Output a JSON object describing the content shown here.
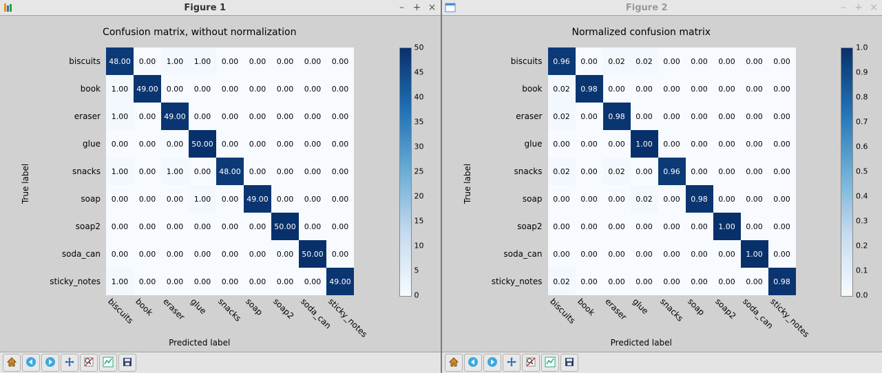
{
  "labels": [
    "biscuits",
    "book",
    "eraser",
    "glue",
    "snacks",
    "soap",
    "soap2",
    "soda_can",
    "sticky_notes"
  ],
  "toolbar_icons": [
    "home-icon",
    "back-icon",
    "forward-icon",
    "pan-icon",
    "zoom-icon",
    "subplots-icon",
    "save-icon"
  ],
  "figure1": {
    "window_title": "Figure 1",
    "chart_title": "Confusion matrix, without normalization",
    "ylabel": "True label",
    "xlabel": "Predicted label",
    "cbar_min": 0,
    "cbar_max": 50,
    "cbar_ticks": [
      0,
      5,
      10,
      15,
      20,
      25,
      30,
      35,
      40,
      45,
      50
    ]
  },
  "figure2": {
    "window_title": "Figure 2",
    "chart_title": "Normalized confusion matrix",
    "ylabel": "True label",
    "xlabel": "Predicted label",
    "cbar_min": 0.0,
    "cbar_max": 1.0,
    "cbar_ticks": [
      0.0,
      0.1,
      0.2,
      0.3,
      0.4,
      0.5,
      0.6,
      0.7,
      0.8,
      0.9,
      1.0
    ]
  },
  "window_buttons": {
    "min": "–",
    "max": "+",
    "close": "×"
  },
  "chart_data": [
    {
      "type": "heatmap",
      "title": "Confusion matrix, without normalization",
      "xlabel": "Predicted label",
      "ylabel": "True label",
      "categories": [
        "biscuits",
        "book",
        "eraser",
        "glue",
        "snacks",
        "soap",
        "soap2",
        "soda_can",
        "sticky_notes"
      ],
      "matrix": [
        [
          48.0,
          0.0,
          1.0,
          1.0,
          0.0,
          0.0,
          0.0,
          0.0,
          0.0
        ],
        [
          1.0,
          49.0,
          0.0,
          0.0,
          0.0,
          0.0,
          0.0,
          0.0,
          0.0
        ],
        [
          1.0,
          0.0,
          49.0,
          0.0,
          0.0,
          0.0,
          0.0,
          0.0,
          0.0
        ],
        [
          0.0,
          0.0,
          0.0,
          50.0,
          0.0,
          0.0,
          0.0,
          0.0,
          0.0
        ],
        [
          1.0,
          0.0,
          1.0,
          0.0,
          48.0,
          0.0,
          0.0,
          0.0,
          0.0
        ],
        [
          0.0,
          0.0,
          0.0,
          1.0,
          0.0,
          49.0,
          0.0,
          0.0,
          0.0
        ],
        [
          0.0,
          0.0,
          0.0,
          0.0,
          0.0,
          0.0,
          50.0,
          0.0,
          0.0
        ],
        [
          0.0,
          0.0,
          0.0,
          0.0,
          0.0,
          0.0,
          0.0,
          50.0,
          0.0
        ],
        [
          1.0,
          0.0,
          0.0,
          0.0,
          0.0,
          0.0,
          0.0,
          0.0,
          49.0
        ]
      ],
      "zlim": [
        0,
        50
      ],
      "colorbar_ticks": [
        0,
        5,
        10,
        15,
        20,
        25,
        30,
        35,
        40,
        45,
        50
      ]
    },
    {
      "type": "heatmap",
      "title": "Normalized confusion matrix",
      "xlabel": "Predicted label",
      "ylabel": "True label",
      "categories": [
        "biscuits",
        "book",
        "eraser",
        "glue",
        "snacks",
        "soap",
        "soap2",
        "soda_can",
        "sticky_notes"
      ],
      "matrix": [
        [
          0.96,
          0.0,
          0.02,
          0.02,
          0.0,
          0.0,
          0.0,
          0.0,
          0.0
        ],
        [
          0.02,
          0.98,
          0.0,
          0.0,
          0.0,
          0.0,
          0.0,
          0.0,
          0.0
        ],
        [
          0.02,
          0.0,
          0.98,
          0.0,
          0.0,
          0.0,
          0.0,
          0.0,
          0.0
        ],
        [
          0.0,
          0.0,
          0.0,
          1.0,
          0.0,
          0.0,
          0.0,
          0.0,
          0.0
        ],
        [
          0.02,
          0.0,
          0.02,
          0.0,
          0.96,
          0.0,
          0.0,
          0.0,
          0.0
        ],
        [
          0.0,
          0.0,
          0.0,
          0.02,
          0.0,
          0.98,
          0.0,
          0.0,
          0.0
        ],
        [
          0.0,
          0.0,
          0.0,
          0.0,
          0.0,
          0.0,
          1.0,
          0.0,
          0.0
        ],
        [
          0.0,
          0.0,
          0.0,
          0.0,
          0.0,
          0.0,
          0.0,
          1.0,
          0.0
        ],
        [
          0.02,
          0.0,
          0.0,
          0.0,
          0.0,
          0.0,
          0.0,
          0.0,
          0.98
        ]
      ],
      "zlim": [
        0.0,
        1.0
      ],
      "colorbar_ticks": [
        0.0,
        0.1,
        0.2,
        0.3,
        0.4,
        0.5,
        0.6,
        0.7,
        0.8,
        0.9,
        1.0
      ]
    }
  ]
}
